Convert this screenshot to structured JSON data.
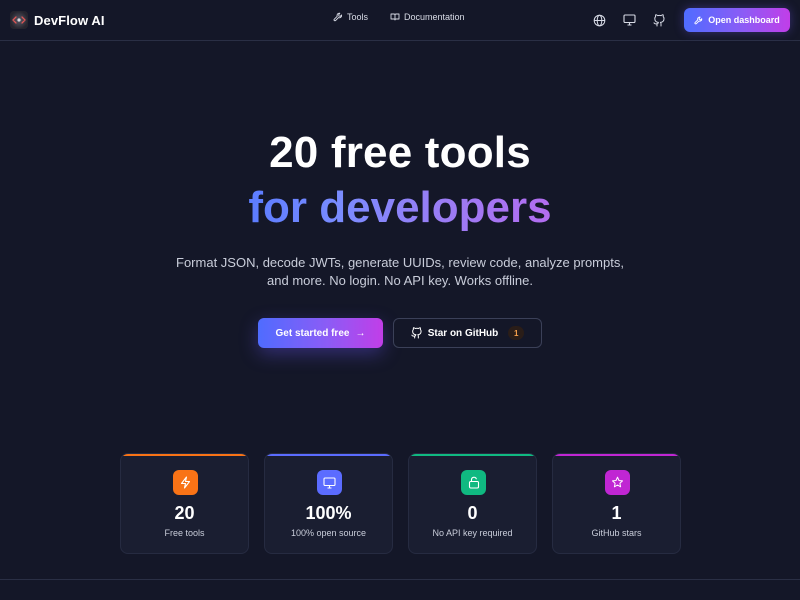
{
  "nav": {
    "brand": "DevFlow AI",
    "links": [
      {
        "label": "Tools",
        "icon": "wrench-icon"
      },
      {
        "label": "Documentation",
        "icon": "book-icon"
      }
    ],
    "icons": [
      "globe-icon",
      "monitor-icon",
      "github-icon"
    ],
    "dashboard_button": "Open dashboard"
  },
  "hero": {
    "title_line1": "20 free tools",
    "title_line2": "for developers",
    "subtitle_line1": "Format JSON, decode JWTs, generate UUIDs, review code, analyze prompts,",
    "subtitle_line2": "and more. No login. No API key. Works offline.",
    "cta_primary": "Get started free",
    "cta_primary_arrow": "→",
    "cta_secondary": "Star on GitHub",
    "star_count": "1"
  },
  "stats": [
    {
      "value": "20",
      "label": "Free tools",
      "icon": "lightning-icon",
      "color": "#f97316",
      "bar": "#f97316"
    },
    {
      "value": "100%",
      "label": "100% open source",
      "icon": "monitor-icon",
      "color": "#5b6cff",
      "bar": "#5b6cff"
    },
    {
      "value": "0",
      "label": "No API key required",
      "icon": "lock-icon",
      "color": "#10b981",
      "bar": "#10b981"
    },
    {
      "value": "1",
      "label": "GitHub stars",
      "icon": "star-icon",
      "color": "#c026d3",
      "bar": "#c026d3"
    }
  ],
  "colors": {
    "background": "#141728",
    "accent_start": "#4f6cff",
    "accent_end": "#c13ee8",
    "card": "#1a1e31"
  }
}
